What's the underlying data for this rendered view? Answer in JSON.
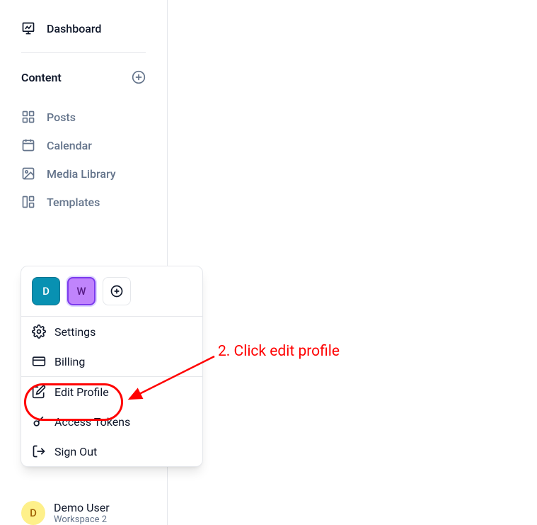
{
  "sidebar": {
    "dashboard": "Dashboard",
    "content_header": "Content",
    "items": {
      "posts": "Posts",
      "calendar": "Calendar",
      "media": "Media Library",
      "templates": "Templates"
    }
  },
  "user": {
    "initial": "D",
    "name": "Demo User",
    "workspace": "Workspace 2"
  },
  "popover": {
    "workspaces": {
      "d": "D",
      "w": "W"
    },
    "items": {
      "settings": "Settings",
      "billing": "Billing",
      "edit_profile": "Edit Profile",
      "access_tokens": "Access Tokens",
      "sign_out": "Sign Out"
    }
  },
  "annotation": {
    "text": "2. Click edit profile"
  }
}
